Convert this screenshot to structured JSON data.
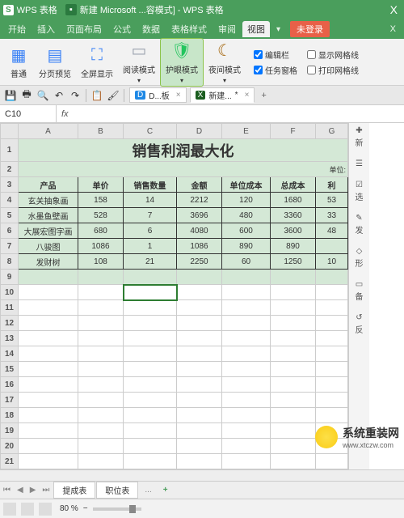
{
  "titlebar": {
    "logo": "S",
    "app": "WPS 表格",
    "doc": "新建 Microsoft ...容模式] - WPS 表格",
    "x": "X"
  },
  "menu": {
    "items": [
      "开始",
      "插入",
      "页面布局",
      "公式",
      "数据",
      "表格样式",
      "审阅",
      "视图"
    ],
    "arrow": "▾",
    "login": "未登录",
    "x": "X"
  },
  "ribbon": {
    "btns": [
      {
        "icon": "▦",
        "label": "普通",
        "color": "#3b82f6"
      },
      {
        "icon": "▤",
        "label": "分页预览",
        "color": "#3b82f6"
      },
      {
        "icon": "⛶",
        "label": "全屏显示",
        "color": "#3b82f6"
      },
      {
        "icon": "▭",
        "label": "阅读模式",
        "color": "#9ca3af"
      },
      {
        "icon": "🛡",
        "label": "护眼模式",
        "color": "#22c55e"
      },
      {
        "icon": "☾",
        "label": "夜间模式",
        "color": "#a16207"
      }
    ],
    "checks": [
      {
        "label": "编辑栏",
        "checked": true
      },
      {
        "label": "任务窗格",
        "checked": true
      },
      {
        "label": "显示网格线",
        "checked": false
      },
      {
        "label": "打印网格线",
        "checked": false
      }
    ]
  },
  "qat": {
    "tabs": [
      {
        "icon": "D",
        "label": "D...板"
      },
      {
        "icon": "X",
        "label": "新建..."
      }
    ],
    "add": "+",
    "star": "*"
  },
  "formula": {
    "cell": "C10",
    "fx": "fx"
  },
  "chart_data": {
    "type": "table",
    "title": "销售利润最大化",
    "unit": "单位:",
    "headers": [
      "产品",
      "单价",
      "销售数量",
      "金额",
      "单位成本",
      "总成本",
      "利"
    ],
    "rows": [
      [
        "玄关抽象画",
        "158",
        "14",
        "2212",
        "120",
        "1680",
        "53"
      ],
      [
        "水墨鱼壁画",
        "528",
        "7",
        "3696",
        "480",
        "3360",
        "33"
      ],
      [
        "大展宏图字画",
        "680",
        "6",
        "4080",
        "600",
        "3600",
        "48"
      ],
      [
        "八骏图",
        "1086",
        "1",
        "1086",
        "890",
        "890",
        ""
      ],
      [
        "发财树",
        "108",
        "21",
        "2250",
        "60",
        "1250",
        "10"
      ]
    ]
  },
  "cols": [
    "A",
    "B",
    "C",
    "D",
    "E",
    "F",
    "G"
  ],
  "side": [
    {
      "icon": "✚",
      "label": "新"
    },
    {
      "icon": "☰",
      "label": ""
    },
    {
      "icon": "☑",
      "label": "选"
    },
    {
      "icon": "✎",
      "label": "发"
    },
    {
      "icon": "◇",
      "label": "形"
    },
    {
      "icon": "▭",
      "label": "备"
    },
    {
      "icon": "↺",
      "label": "反"
    }
  ],
  "sheettabs": {
    "tabs": [
      "提成表",
      "职位表"
    ],
    "dots": "...",
    "add": "+"
  },
  "status": {
    "zoom": "80 %"
  },
  "watermark": {
    "name": "系统重装网",
    "url": "www.xtczw.com"
  }
}
